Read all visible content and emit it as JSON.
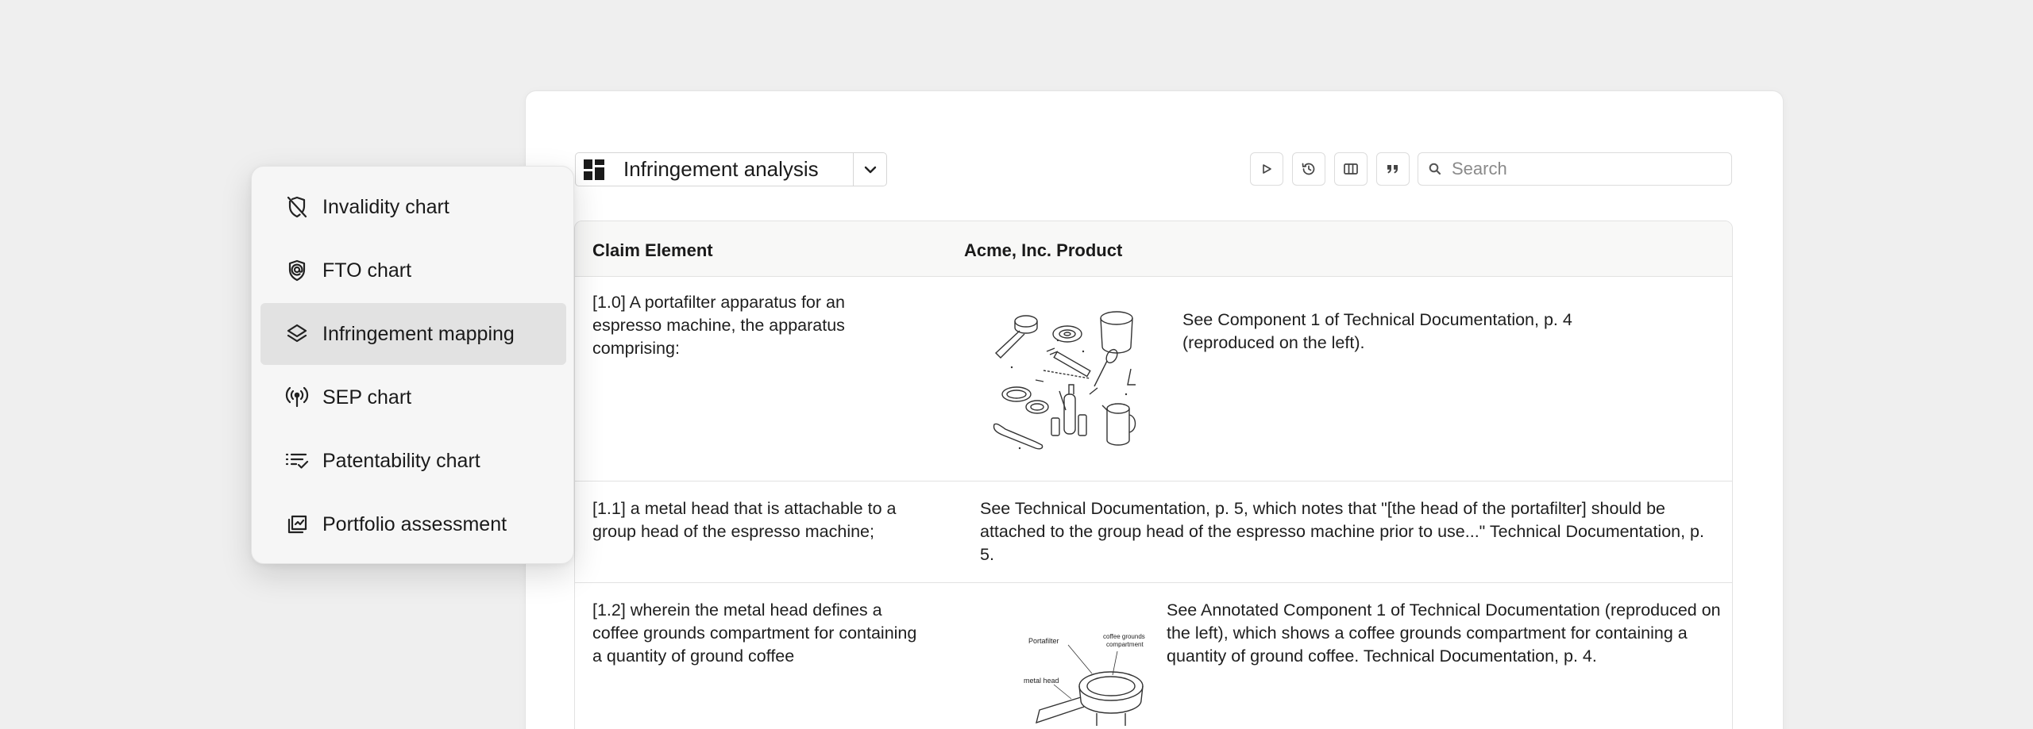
{
  "toolbar": {
    "chart_type": "Infringement analysis",
    "search_placeholder": "Search"
  },
  "table": {
    "headers": [
      "Claim Element",
      "Acme, Inc. Product"
    ],
    "rows": [
      {
        "claim": "[1.0] A portafilter apparatus for an espresso machine, the apparatus comprising:",
        "evidence": "See Component 1 of Technical Documentation, p. 4 (reproduced on the left)."
      },
      {
        "claim": "[1.1] a metal head that is attachable to a group head of the espresso machine;",
        "evidence": "See Technical Documentation, p. 5, which notes that \"[the head of the portafilter] should be attached to the group head of the espresso machine prior to use...\" Technical Documentation, p. 5."
      },
      {
        "claim": "[1.2] wherein the metal head defines a coffee grounds compartment for containing a quantity of ground coffee",
        "evidence": "See Annotated Component 1 of Technical Documentation (reproduced on the left), which shows a coffee grounds compartment for containing a quantity of ground coffee. Technical Documentation, p. 4."
      }
    ],
    "diagram_labels": {
      "portafilter": "Portafilter",
      "compartment": "coffee grounds compartment",
      "metal_head": "metal head"
    }
  },
  "menu": {
    "items": [
      {
        "label": "Invalidity chart",
        "icon": "shield-off-icon"
      },
      {
        "label": "FTO chart",
        "icon": "shield-at-icon"
      },
      {
        "label": "Infringement mapping",
        "icon": "layers-icon",
        "active": true
      },
      {
        "label": "SEP chart",
        "icon": "broadcast-icon"
      },
      {
        "label": "Patentability chart",
        "icon": "list-check-icon"
      },
      {
        "label": "Portfolio assessment",
        "icon": "portfolio-stack-icon"
      }
    ]
  }
}
